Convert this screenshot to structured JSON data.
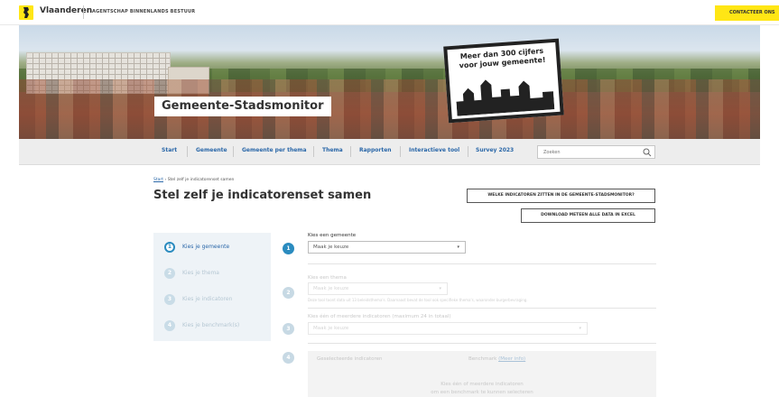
{
  "topbar": {
    "brand": "Vlaanderen",
    "agency": "AGENTSCHAP BINNENLANDS BESTUUR",
    "contact": "CONTACTEER ONS"
  },
  "hero": {
    "title": "Gemeente-Stadsmonitor",
    "bubble_line1": "Meer dan 300 cijfers",
    "bubble_line2": "voor jouw gemeente!"
  },
  "nav": {
    "items": [
      "Start",
      "Gemeente",
      "Gemeente per thema",
      "Thema",
      "Rapporten",
      "Interactieve tool",
      "Survey 2023"
    ],
    "search_placeholder": "Zoeken"
  },
  "breadcrumb": {
    "home": "Start",
    "separator": "›",
    "current": "Stel zelf je indicatorenset samen"
  },
  "page": {
    "title": "Stel zelf je indicatorenset samen",
    "btn_indicators": "WELKE INDICATOREN ZITTEN IN DE GEMEENTE-STADSMONITOR?",
    "btn_download": "DOWNLOAD METEEN ALLE DATA IN EXCEL"
  },
  "steps": [
    {
      "num": "1",
      "label": "Kies je gemeente",
      "active": true
    },
    {
      "num": "2",
      "label": "Kies je thema",
      "active": false
    },
    {
      "num": "3",
      "label": "Kies je indicatoren",
      "active": false
    },
    {
      "num": "4",
      "label": "Kies je benchmark(s)",
      "active": false
    }
  ],
  "form": {
    "step1": {
      "num": "1",
      "label": "Kies een gemeente",
      "value": "Maak je keuze"
    },
    "step2": {
      "num": "2",
      "label": "Kies een thema",
      "value": "Maak je keuze",
      "hint": "Deze tool toont data uit 13 beleidsthema's. Daarnaast bevat de tool ook specifieke thema's, waaronder burgerbevraging."
    },
    "step3": {
      "num": "3",
      "label": "Kies één of meerdere indicatoren (maximum 24 in totaal)",
      "value": "Maak je keuze"
    },
    "step4": {
      "num": "4",
      "col_indicator": "Geselecteerde indicatoren",
      "col_benchmark": "Benchmark",
      "more_info": "(Meer info)",
      "empty_line1": "Kies één of meerdere indicatoren",
      "empty_line2": "om een benchmark te kunnen selecteren"
    }
  },
  "colors": {
    "brand_yellow": "#ffe615",
    "link_blue": "#2a67a8",
    "step_blue": "#2a8bbf"
  }
}
